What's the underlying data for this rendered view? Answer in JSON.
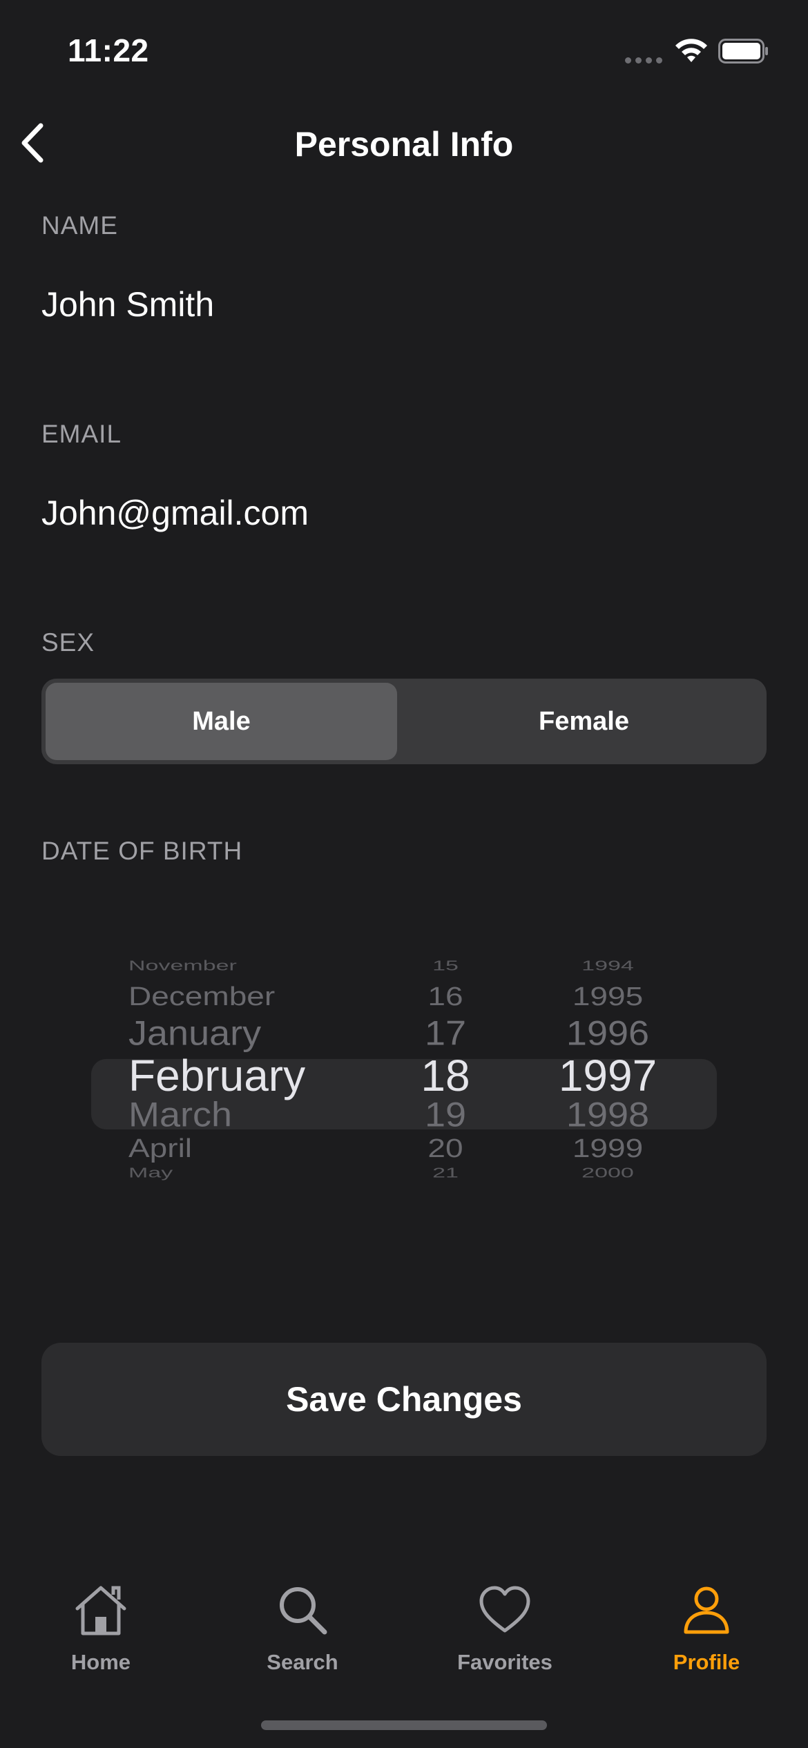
{
  "status_bar": {
    "time": "11:22"
  },
  "nav": {
    "title": "Personal Info"
  },
  "form": {
    "name": {
      "label": "NAME",
      "value": "John Smith"
    },
    "email": {
      "label": "EMAIL",
      "value": "John@gmail.com"
    },
    "sex": {
      "label": "SEX",
      "options": [
        "Male",
        "Female"
      ],
      "selected": "Male"
    },
    "dob": {
      "label": "DATE OF BIRTH",
      "months": [
        "November",
        "December",
        "January",
        "February",
        "March",
        "April",
        "May"
      ],
      "days": [
        "15",
        "16",
        "17",
        "18",
        "19",
        "20",
        "21"
      ],
      "years": [
        "1994",
        "1995",
        "1996",
        "1997",
        "1998",
        "1999",
        "2000"
      ],
      "selected": {
        "month": "February",
        "day": "18",
        "year": "1997"
      }
    }
  },
  "save_button": {
    "label": "Save Changes"
  },
  "tab_bar": {
    "active": "Profile",
    "accent_color": "#ff9f0a",
    "items": [
      {
        "label": "Home",
        "icon": "house-icon"
      },
      {
        "label": "Search",
        "icon": "magnifier-icon"
      },
      {
        "label": "Favorites",
        "icon": "heart-icon"
      },
      {
        "label": "Profile",
        "icon": "person-icon"
      }
    ]
  }
}
